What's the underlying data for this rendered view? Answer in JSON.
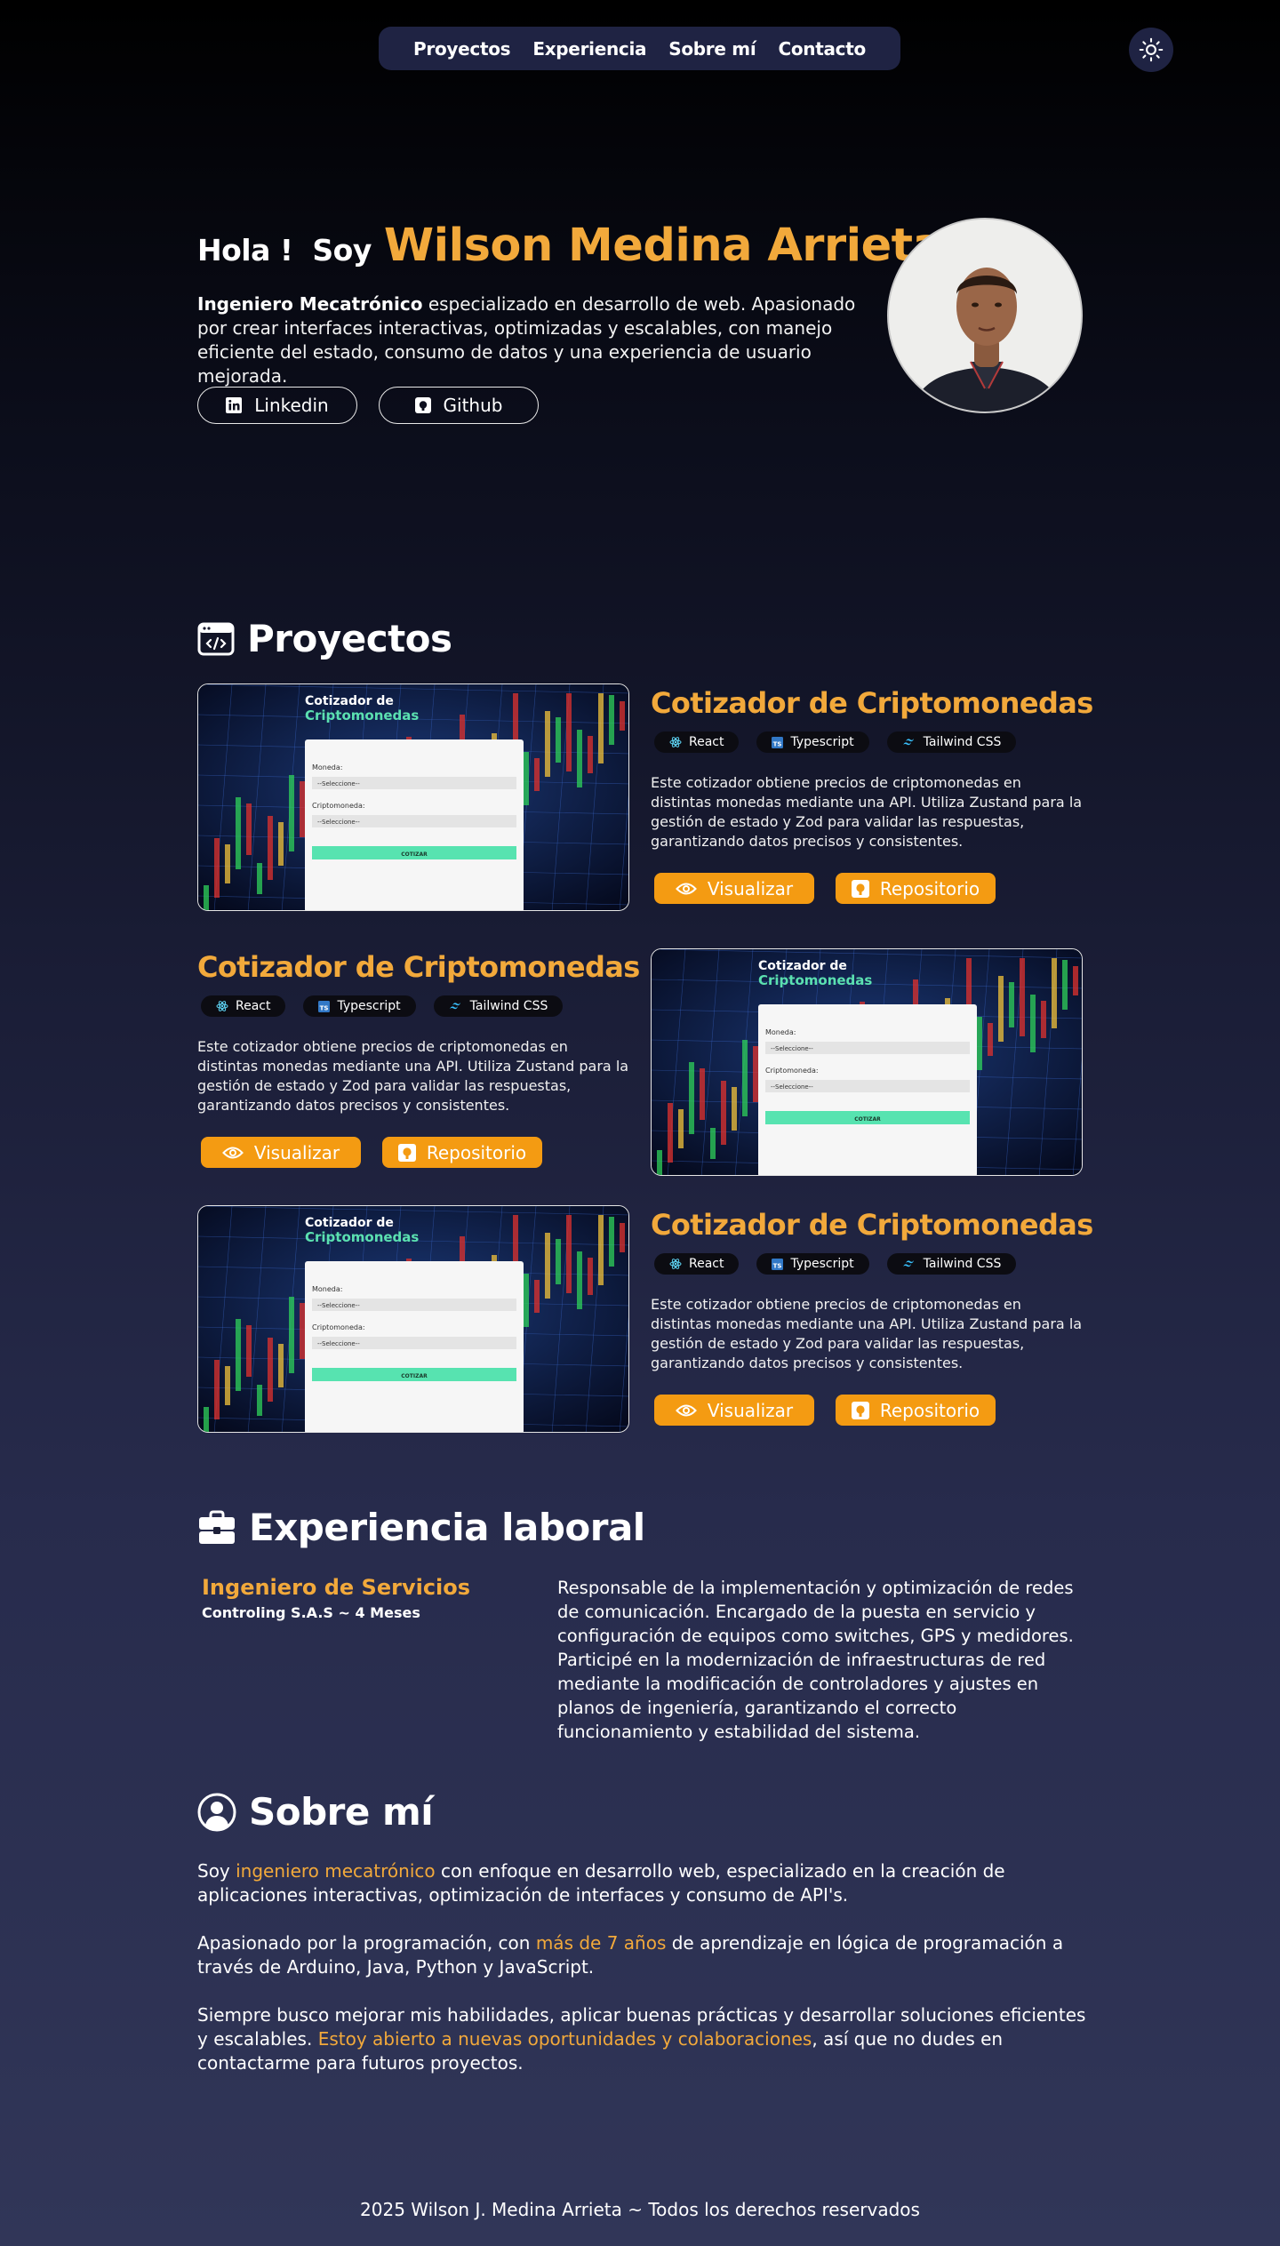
{
  "nav": {
    "items": [
      "Proyectos",
      "Experiencia",
      "Sobre mí",
      "Contacto"
    ],
    "theme_icon": "sun-icon"
  },
  "hero": {
    "greeting": "Hola ! ",
    "soy": "Soy",
    "name": "Wilson Medina Arrieta",
    "desc_bold": "Ingeniero Mecatrónico",
    "desc_rest": " especializado en desarrollo de web. Apasionado por crear interfaces interactivas, optimizadas y escalables, con manejo eficiente del estado, consumo de datos y una experiencia de usuario mejorada.",
    "linkedin_label": "Linkedin",
    "github_label": "Github"
  },
  "projects": {
    "heading": "Proyectos",
    "items": [
      {
        "title": "Cotizador de Criptomonedas",
        "tags": [
          "React",
          "Typescript",
          "Tailwind CSS"
        ],
        "desc": "Este cotizador obtiene precios de criptomonedas en distintas monedas mediante una API. Utiliza Zustand para la gestión de estado y Zod para validar las respuestas, garantizando datos precisos y consistentes.",
        "view_label": "Visualizar",
        "repo_label": "Repositorio"
      },
      {
        "title": "Cotizador de Criptomonedas",
        "tags": [
          "React",
          "Typescript",
          "Tailwind CSS"
        ],
        "desc": "Este cotizador obtiene precios de criptomonedas en distintas monedas mediante una API. Utiliza Zustand para la gestión de estado y Zod para validar las respuestas, garantizando datos precisos y consistentes.",
        "view_label": "Visualizar",
        "repo_label": "Repositorio"
      },
      {
        "title": "Cotizador de Criptomonedas",
        "tags": [
          "React",
          "Typescript",
          "Tailwind CSS"
        ],
        "desc": "Este cotizador obtiene precios de criptomonedas en distintas monedas mediante una API. Utiliza Zustand para la gestión de estado y Zod para validar las respuestas, garantizando datos precisos y consistentes.",
        "view_label": "Visualizar",
        "repo_label": "Repositorio"
      }
    ],
    "screenshot": {
      "title_line1": "Cotizador de",
      "title_line2": "Criptomonedas",
      "label_moneda": "Moneda:",
      "label_cripto": "Criptomoneda:",
      "select_value": "--Seleccione--",
      "button": "COTIZAR"
    }
  },
  "experience": {
    "heading": "Experiencia laboral",
    "role": "Ingeniero de Servicios",
    "company": "Controling S.A.S ~ 4 Meses",
    "desc": "Responsable de la implementación y optimización de redes de comunicación. Encargado de la puesta en servicio y configuración de equipos como switches, GPS y medidores. Participé en la modernización de infraestructuras de red mediante la modificación de controladores y ajustes en planos de ingeniería, garantizando el correcto funcionamiento y estabilidad del sistema."
  },
  "about": {
    "heading": "Sobre mí",
    "p1_a": "Soy ",
    "p1_hl": "ingeniero mecatrónico",
    "p1_b": " con enfoque en desarrollo web, especializado en la creación de aplicaciones interactivas, optimización de interfaces y consumo de API's.",
    "p2_a": "Apasionado por la programación, con ",
    "p2_hl": "más de 7 años",
    "p2_b": " de aprendizaje en lógica de programación a través de Arduino, Java, Python y JavaScript.",
    "p3_a": "Siempre busco mejorar mis habilidades, aplicar buenas prácticas y desarrollar soluciones eficientes y escalables. ",
    "p3_hl": "Estoy abierto a nuevas oportunidades y colaboraciones",
    "p3_b": ", así que no dudes en contactarme para futuros proyectos."
  },
  "footer": {
    "text": "2025 Wilson J. Medina Arrieta ~ Todos los derechos reservados"
  },
  "colors": {
    "accent": "#f2a93b",
    "button": "#f49b12",
    "nav_bg": "#1f2343"
  }
}
